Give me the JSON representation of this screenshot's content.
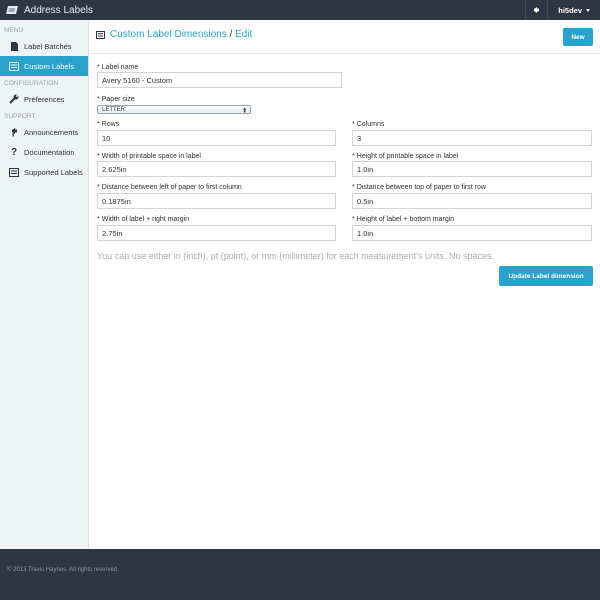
{
  "app": {
    "title": "Address Labels"
  },
  "navbar": {
    "user": "hi5dev"
  },
  "sidebar": {
    "sections": [
      {
        "heading": "MENU",
        "items": [
          {
            "label": "Label Batches",
            "icon": "file-icon"
          },
          {
            "label": "Custom Labels",
            "icon": "list-icon",
            "active": true
          }
        ]
      },
      {
        "heading": "CONFIGURATION",
        "items": [
          {
            "label": "Preferences",
            "icon": "wrench-icon"
          }
        ]
      },
      {
        "heading": "SUPPORT",
        "items": [
          {
            "label": "Announcements",
            "icon": "bullhorn-icon"
          },
          {
            "label": "Documentation",
            "icon": "question-icon"
          },
          {
            "label": "Supported Labels",
            "icon": "list-icon"
          }
        ]
      }
    ]
  },
  "page": {
    "title_link": "Custom Label Dimensions",
    "title_separator": "/",
    "title_current": "Edit",
    "new_button": "New"
  },
  "form": {
    "required_marker": "*",
    "label_name": {
      "label": "Label name",
      "value": "Avery 5160 - Custom"
    },
    "paper_size": {
      "label": "Paper size",
      "value": "LETTER"
    },
    "rows": {
      "label": "Rows",
      "value": "10"
    },
    "columns": {
      "label": "Columns",
      "value": "3"
    },
    "printable_width": {
      "label": "Width of printable space in label",
      "value": "2.625in"
    },
    "printable_height": {
      "label": "Height of printable space in label",
      "value": "1.0in"
    },
    "left_margin": {
      "label": "Distance between left of paper to first column",
      "value": "0.1875in"
    },
    "top_margin": {
      "label": "Distance between top of paper to first row",
      "value": "0.5in"
    },
    "label_right_margin": {
      "label": "Width of label + right margin",
      "value": "2.75in"
    },
    "label_bottom_margin": {
      "label": "Height of label + bottom margin",
      "value": "1.0in"
    },
    "hint": "You can use either in (inch), pt (point), or mm (millimeter) for each measurement's units. No spaces.",
    "submit_button": "Update Label dimension"
  },
  "footer": {
    "copyright": "© 2013 Travis Haynes. All rights reserved."
  },
  "colors": {
    "navbar": "#2d3645",
    "accent": "#29a3cc",
    "sidebar_bg": "#eef3f6"
  }
}
